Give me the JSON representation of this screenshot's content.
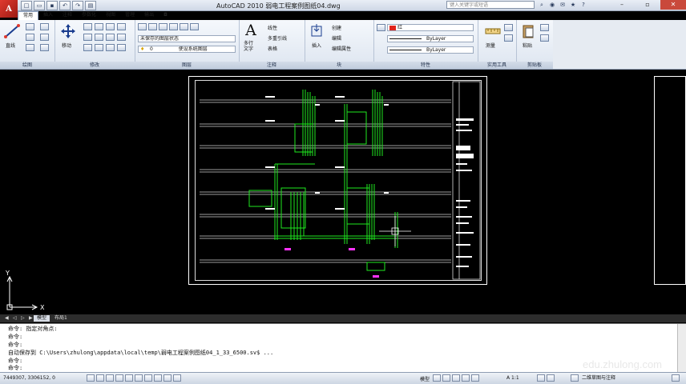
{
  "app": {
    "logo_letter": "A",
    "title": "AutoCAD 2010    弱电工程案例图纸04.dwg"
  },
  "search": {
    "placeholder": "键入关键字或短语"
  },
  "tabs": [
    "常用",
    "插入",
    "注释",
    "参数化",
    "视图",
    "管理",
    "输出",
    "◘"
  ],
  "active_tab": "常用",
  "ribbon": {
    "draw": {
      "title": "绘图",
      "line_label": "直线"
    },
    "modify": {
      "title": "修改",
      "move_label": "移动"
    },
    "layers": {
      "title": "图层",
      "layer_state": "未保存的图层状态",
      "current_layer": "0",
      "system_layer": "使设系统图层"
    },
    "annotation": {
      "title": "注释",
      "text_label": "多行\n文字",
      "linear": "线性",
      "multileader": "多重引线",
      "table": "表格"
    },
    "block": {
      "title": "块",
      "insert_label": "插入",
      "create": "创建",
      "edit": "编辑",
      "edit_attr": "编辑属性"
    },
    "properties": {
      "title": "特性",
      "color": "红",
      "color_hex": "#e0241c",
      "linetype": "ByLayer",
      "lineweight": "ByLayer"
    },
    "utilities": {
      "title": "实用工具",
      "measure_label": "测量"
    },
    "clipboard": {
      "title": "剪贴板",
      "paste_label": "粘贴"
    }
  },
  "layout_tabs": [
    "模型",
    "布局1"
  ],
  "active_layout": "模型",
  "ucs": {
    "x_label": "X",
    "y_label": "Y"
  },
  "command": {
    "lines": [
      "命令: 指定对角点:",
      "命令:",
      "命令:",
      "自动保存到 C:\\Users\\zhulong\\appdata\\local\\temp\\弱电工程案例图纸04_1_33_6500.sv$ ...",
      "命令:"
    ],
    "prompt": "命令:"
  },
  "status": {
    "coords": "7449307, 3306152, 0",
    "model_label": "模型",
    "scale": "A 1:1",
    "workspace": "二维草图与注释"
  },
  "watermark": "edu.zhulong.com",
  "colors": {
    "background": "#000000",
    "wiring": "#1fe81f",
    "text": "#ffffff",
    "magenta": "#ff33ff"
  }
}
